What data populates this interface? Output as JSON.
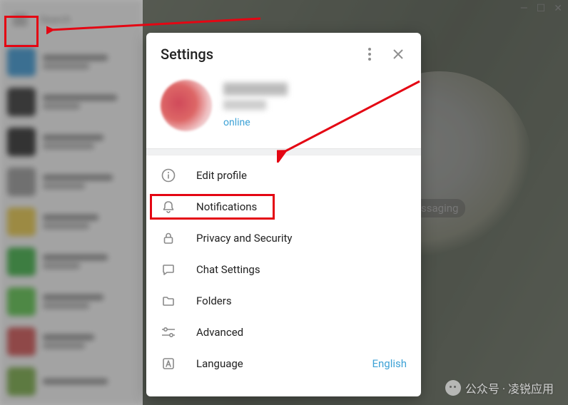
{
  "window": {
    "search_placeholder": "Search"
  },
  "settings": {
    "title": "Settings",
    "profile": {
      "status": "online"
    },
    "menu": [
      {
        "key": "edit-profile",
        "label": "Edit profile",
        "icon": "info-icon"
      },
      {
        "key": "notifications",
        "label": "Notifications",
        "icon": "bell-icon"
      },
      {
        "key": "privacy",
        "label": "Privacy and Security",
        "icon": "lock-icon"
      },
      {
        "key": "chat-settings",
        "label": "Chat Settings",
        "icon": "chat-icon"
      },
      {
        "key": "folders",
        "label": "Folders",
        "icon": "folder-icon"
      },
      {
        "key": "advanced",
        "label": "Advanced",
        "icon": "sliders-icon"
      },
      {
        "key": "language",
        "label": "Language",
        "icon": "language-icon",
        "trailing": "English"
      }
    ]
  },
  "background_text": "ssaging",
  "watermark": "公众号 · 凌锐应用"
}
